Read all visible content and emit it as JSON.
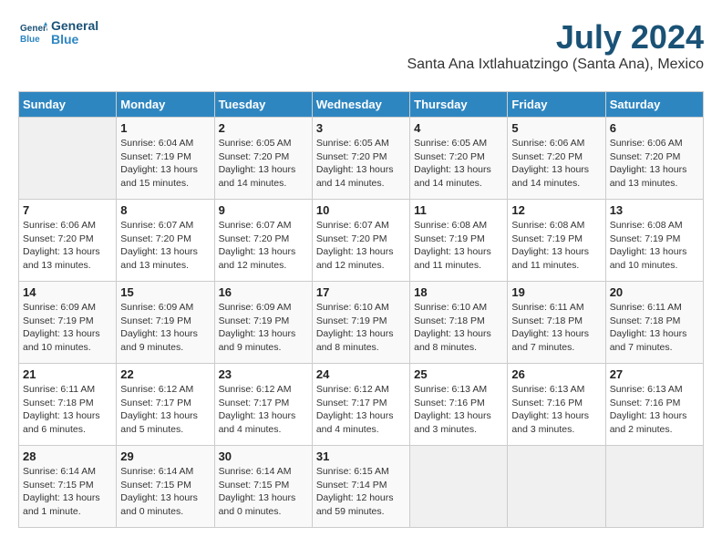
{
  "logo": {
    "line1": "General",
    "line2": "Blue"
  },
  "title": "July 2024",
  "subtitle": "Santa Ana Ixtlahuatzingo (Santa Ana), Mexico",
  "days_of_week": [
    "Sunday",
    "Monday",
    "Tuesday",
    "Wednesday",
    "Thursday",
    "Friday",
    "Saturday"
  ],
  "weeks": [
    [
      {
        "day": "",
        "info": ""
      },
      {
        "day": "1",
        "info": "Sunrise: 6:04 AM\nSunset: 7:19 PM\nDaylight: 13 hours\nand 15 minutes."
      },
      {
        "day": "2",
        "info": "Sunrise: 6:05 AM\nSunset: 7:20 PM\nDaylight: 13 hours\nand 14 minutes."
      },
      {
        "day": "3",
        "info": "Sunrise: 6:05 AM\nSunset: 7:20 PM\nDaylight: 13 hours\nand 14 minutes."
      },
      {
        "day": "4",
        "info": "Sunrise: 6:05 AM\nSunset: 7:20 PM\nDaylight: 13 hours\nand 14 minutes."
      },
      {
        "day": "5",
        "info": "Sunrise: 6:06 AM\nSunset: 7:20 PM\nDaylight: 13 hours\nand 14 minutes."
      },
      {
        "day": "6",
        "info": "Sunrise: 6:06 AM\nSunset: 7:20 PM\nDaylight: 13 hours\nand 13 minutes."
      }
    ],
    [
      {
        "day": "7",
        "info": "Sunrise: 6:06 AM\nSunset: 7:20 PM\nDaylight: 13 hours\nand 13 minutes."
      },
      {
        "day": "8",
        "info": "Sunrise: 6:07 AM\nSunset: 7:20 PM\nDaylight: 13 hours\nand 13 minutes."
      },
      {
        "day": "9",
        "info": "Sunrise: 6:07 AM\nSunset: 7:20 PM\nDaylight: 13 hours\nand 12 minutes."
      },
      {
        "day": "10",
        "info": "Sunrise: 6:07 AM\nSunset: 7:20 PM\nDaylight: 13 hours\nand 12 minutes."
      },
      {
        "day": "11",
        "info": "Sunrise: 6:08 AM\nSunset: 7:19 PM\nDaylight: 13 hours\nand 11 minutes."
      },
      {
        "day": "12",
        "info": "Sunrise: 6:08 AM\nSunset: 7:19 PM\nDaylight: 13 hours\nand 11 minutes."
      },
      {
        "day": "13",
        "info": "Sunrise: 6:08 AM\nSunset: 7:19 PM\nDaylight: 13 hours\nand 10 minutes."
      }
    ],
    [
      {
        "day": "14",
        "info": "Sunrise: 6:09 AM\nSunset: 7:19 PM\nDaylight: 13 hours\nand 10 minutes."
      },
      {
        "day": "15",
        "info": "Sunrise: 6:09 AM\nSunset: 7:19 PM\nDaylight: 13 hours\nand 9 minutes."
      },
      {
        "day": "16",
        "info": "Sunrise: 6:09 AM\nSunset: 7:19 PM\nDaylight: 13 hours\nand 9 minutes."
      },
      {
        "day": "17",
        "info": "Sunrise: 6:10 AM\nSunset: 7:19 PM\nDaylight: 13 hours\nand 8 minutes."
      },
      {
        "day": "18",
        "info": "Sunrise: 6:10 AM\nSunset: 7:18 PM\nDaylight: 13 hours\nand 8 minutes."
      },
      {
        "day": "19",
        "info": "Sunrise: 6:11 AM\nSunset: 7:18 PM\nDaylight: 13 hours\nand 7 minutes."
      },
      {
        "day": "20",
        "info": "Sunrise: 6:11 AM\nSunset: 7:18 PM\nDaylight: 13 hours\nand 7 minutes."
      }
    ],
    [
      {
        "day": "21",
        "info": "Sunrise: 6:11 AM\nSunset: 7:18 PM\nDaylight: 13 hours\nand 6 minutes."
      },
      {
        "day": "22",
        "info": "Sunrise: 6:12 AM\nSunset: 7:17 PM\nDaylight: 13 hours\nand 5 minutes."
      },
      {
        "day": "23",
        "info": "Sunrise: 6:12 AM\nSunset: 7:17 PM\nDaylight: 13 hours\nand 4 minutes."
      },
      {
        "day": "24",
        "info": "Sunrise: 6:12 AM\nSunset: 7:17 PM\nDaylight: 13 hours\nand 4 minutes."
      },
      {
        "day": "25",
        "info": "Sunrise: 6:13 AM\nSunset: 7:16 PM\nDaylight: 13 hours\nand 3 minutes."
      },
      {
        "day": "26",
        "info": "Sunrise: 6:13 AM\nSunset: 7:16 PM\nDaylight: 13 hours\nand 3 minutes."
      },
      {
        "day": "27",
        "info": "Sunrise: 6:13 AM\nSunset: 7:16 PM\nDaylight: 13 hours\nand 2 minutes."
      }
    ],
    [
      {
        "day": "28",
        "info": "Sunrise: 6:14 AM\nSunset: 7:15 PM\nDaylight: 13 hours\nand 1 minute."
      },
      {
        "day": "29",
        "info": "Sunrise: 6:14 AM\nSunset: 7:15 PM\nDaylight: 13 hours\nand 0 minutes."
      },
      {
        "day": "30",
        "info": "Sunrise: 6:14 AM\nSunset: 7:15 PM\nDaylight: 13 hours\nand 0 minutes."
      },
      {
        "day": "31",
        "info": "Sunrise: 6:15 AM\nSunset: 7:14 PM\nDaylight: 12 hours\nand 59 minutes."
      },
      {
        "day": "",
        "info": ""
      },
      {
        "day": "",
        "info": ""
      },
      {
        "day": "",
        "info": ""
      }
    ]
  ]
}
